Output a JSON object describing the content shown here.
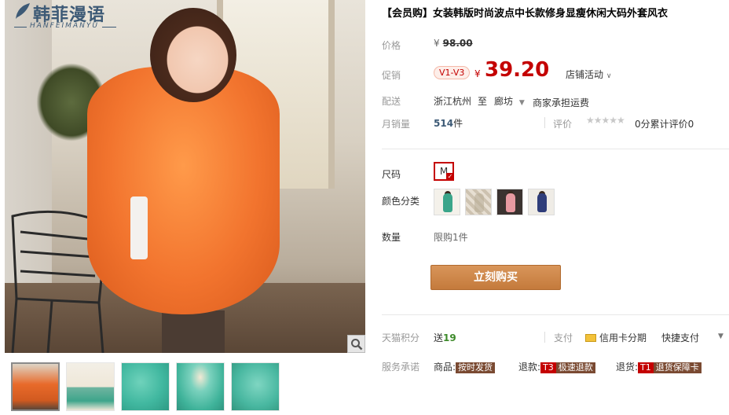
{
  "logo": {
    "cn": "韩菲漫语",
    "en": "HANFEIMANYU"
  },
  "product": {
    "title": "【会员购】女装韩版时尚波点中长款修身显瘦休闲大码外套风衣"
  },
  "price": {
    "label": "价格",
    "currency": "¥",
    "original": "98.00"
  },
  "promo": {
    "label": "促销",
    "badge": "V1-V3",
    "currency": "¥",
    "price": "39.20",
    "shop_activity": "店铺活动"
  },
  "shipping": {
    "label": "配送",
    "from": "浙江杭州",
    "to_word": "至",
    "destination": "廊坊",
    "fee_note": "商家承担运费"
  },
  "sales": {
    "label": "月销量",
    "count": "514",
    "unit": "件",
    "rating_label": "评价",
    "stars": "★★★★★",
    "rating_text": "0分累计评价0"
  },
  "size": {
    "label": "尺码",
    "selected": "M"
  },
  "colors": {
    "label": "颜色分类",
    "options": [
      "#3aa58a",
      "#cdc2b0",
      "#e79aa1",
      "#2f3d7a"
    ]
  },
  "quantity": {
    "label": "数量",
    "limit": "限购1件"
  },
  "buy_button": "立刻购买",
  "points": {
    "label": "天猫积分",
    "give": "送",
    "amount": "19",
    "pay_label": "支付",
    "credit_installment": "信用卡分期",
    "quick_pay": "快捷支付"
  },
  "service": {
    "label": "服务承诺",
    "goods_prefix": "商品:",
    "goods_tag": "按时发货",
    "return_prefix": "退款:",
    "return_code": "T3",
    "return_tag": "极速退款",
    "exchange_prefix": "退货:",
    "exchange_code": "T1",
    "exchange_tag": "退货保障卡"
  },
  "thumb_colors": [
    "#e86a2a",
    "#efe7d8",
    "#41b8a0",
    "#3fb39a",
    "#48b7a0"
  ],
  "theme": {
    "accent": "#c40000",
    "button": "#c47a3c",
    "logo": "#3d5a76"
  }
}
